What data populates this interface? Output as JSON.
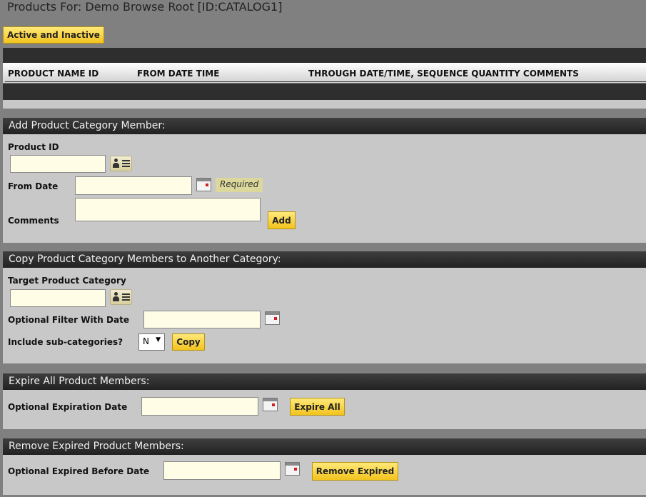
{
  "page": {
    "title": "Products For: Demo Browse Root [ID:CATALOG1]"
  },
  "toolbar": {
    "active_inactive_label": "Active and Inactive"
  },
  "table": {
    "columns": [
      "PRODUCT NAME ID",
      "FROM DATE TIME",
      "THROUGH DATE/TIME, SEQUENCE QUANTITY COMMENTS"
    ]
  },
  "add_member": {
    "header": "Add Product Category Member:",
    "product_id_label": "Product ID",
    "product_id_value": "",
    "from_date_label": "From Date",
    "from_date_value": "",
    "required_text": "Required",
    "comments_label": "Comments",
    "comments_value": "",
    "add_label": "Add"
  },
  "copy_members": {
    "header": "Copy Product Category Members to Another Category:",
    "target_label": "Target Product Category",
    "target_value": "",
    "filter_date_label": "Optional Filter With Date",
    "filter_date_value": "",
    "include_sub_label": "Include sub-categories?",
    "include_sub_value": "N",
    "copy_label": "Copy"
  },
  "expire_all": {
    "header": "Expire All Product Members:",
    "date_label": "Optional Expiration Date",
    "date_value": "",
    "button_label": "Expire All"
  },
  "remove_expired": {
    "header": "Remove Expired Product Members:",
    "date_label": "Optional Expired Before Date",
    "date_value": "",
    "button_label": "Remove Expired"
  },
  "colors": {
    "page_bg": "#808080",
    "panel_bg": "#c8c8c8",
    "header_bg": "#2e2e2e",
    "button_yellow": "#f2c31e",
    "input_bg": "#fffde6",
    "required_bg": "#dcd79a"
  },
  "icons": {
    "lookup": "contact-card-icon",
    "calendar": "calendar-icon"
  }
}
